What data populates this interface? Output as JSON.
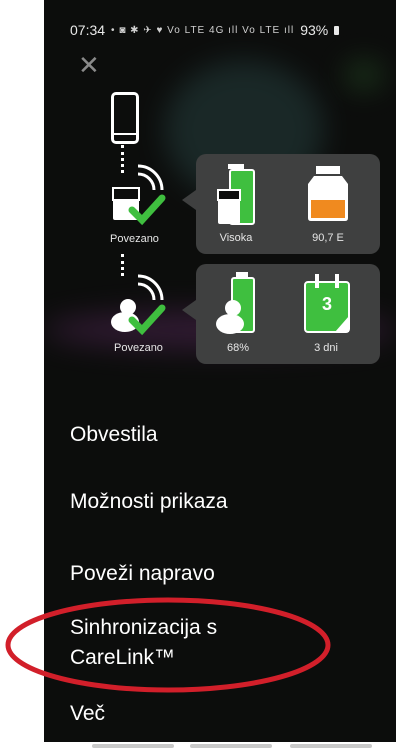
{
  "status_bar": {
    "time": "07:34",
    "indicators": "• ◙ ✱ ✈ ♥ Vo LTE 4G ıll Vo LTE ıll",
    "battery": "93%"
  },
  "connection": {
    "pump": {
      "status": "Povezano",
      "battery_label": "Visoka",
      "reservoir_label": "90,7 E"
    },
    "sensor": {
      "status": "Povezano",
      "battery_label": "68%",
      "calendar_value": "3",
      "calendar_label": "3 dni"
    }
  },
  "menu": {
    "items": [
      {
        "label": "Obvestila"
      },
      {
        "label": "Možnosti prikaza"
      },
      {
        "label": "Poveži napravo"
      },
      {
        "label": "Sinhronizacija s\nCareLink™"
      },
      {
        "label": "Več"
      }
    ]
  },
  "colors": {
    "accent_green": "#3fbf3f",
    "reservoir_orange": "#f08a1f",
    "highlight_circle": "#d21f2a",
    "panel_bg": "#3f4040"
  }
}
